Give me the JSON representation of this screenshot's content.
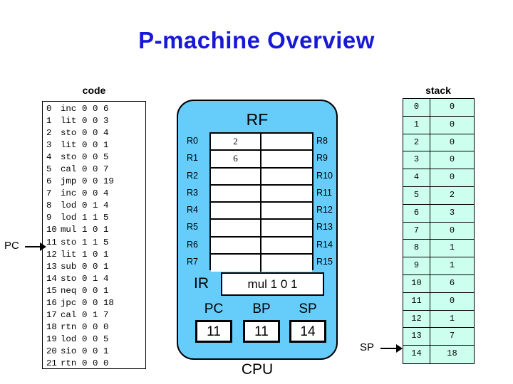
{
  "title": "P-machine Overview",
  "title_color": "#1818d8",
  "code_panel": {
    "header": "code",
    "pointer_label": "PC",
    "pointer_target_line": 11,
    "instructions": [
      {
        "index": "0",
        "op": "inc",
        "l": "0",
        "m": "0",
        "n": "6"
      },
      {
        "index": "1",
        "op": "lit",
        "l": "0",
        "m": "0",
        "n": "3"
      },
      {
        "index": "2",
        "op": "sto",
        "l": "0",
        "m": "0",
        "n": "4"
      },
      {
        "index": "3",
        "op": "lit",
        "l": "0",
        "m": "0",
        "n": "1"
      },
      {
        "index": "4",
        "op": "sto",
        "l": "0",
        "m": "0",
        "n": "5"
      },
      {
        "index": "5",
        "op": "cal",
        "l": "0",
        "m": "0",
        "n": "7"
      },
      {
        "index": "6",
        "op": "jmp",
        "l": "0",
        "m": "0",
        "n": "19"
      },
      {
        "index": "7",
        "op": "inc",
        "l": "0",
        "m": "0",
        "n": "4"
      },
      {
        "index": "8",
        "op": "lod",
        "l": "0",
        "m": "1",
        "n": "4"
      },
      {
        "index": "9",
        "op": "lod",
        "l": "1",
        "m": "1",
        "n": "5"
      },
      {
        "index": "10",
        "op": "mul",
        "l": "1",
        "m": "0",
        "n": "1"
      },
      {
        "index": "11",
        "op": "sto",
        "l": "1",
        "m": "1",
        "n": "5"
      },
      {
        "index": "12",
        "op": "lit",
        "l": "1",
        "m": "0",
        "n": "1"
      },
      {
        "index": "13",
        "op": "sub",
        "l": "0",
        "m": "0",
        "n": "1"
      },
      {
        "index": "14",
        "op": "sto",
        "l": "0",
        "m": "1",
        "n": "4"
      },
      {
        "index": "15",
        "op": "neq",
        "l": "0",
        "m": "0",
        "n": "1"
      },
      {
        "index": "16",
        "op": "jpc",
        "l": "0",
        "m": "0",
        "n": "18"
      },
      {
        "index": "17",
        "op": "cal",
        "l": "0",
        "m": "1",
        "n": "7"
      },
      {
        "index": "18",
        "op": "rtn",
        "l": "0",
        "m": "0",
        "n": "0"
      },
      {
        "index": "19",
        "op": "lod",
        "l": "0",
        "m": "0",
        "n": "5"
      },
      {
        "index": "20",
        "op": "sio",
        "l": "0",
        "m": "0",
        "n": "1"
      },
      {
        "index": "21",
        "op": "rtn",
        "l": "0",
        "m": "0",
        "n": "0"
      }
    ]
  },
  "cpu": {
    "caption": "CPU",
    "fill_color": "#66CCFA",
    "rf_title": "RF",
    "registers": [
      {
        "left_label": "R0",
        "left_value": "2",
        "right_label": "R8",
        "right_value": ""
      },
      {
        "left_label": "R1",
        "left_value": "6",
        "right_label": "R9",
        "right_value": ""
      },
      {
        "left_label": "R2",
        "left_value": "",
        "right_label": "R10",
        "right_value": ""
      },
      {
        "left_label": "R3",
        "left_value": "",
        "right_label": "R11",
        "right_value": ""
      },
      {
        "left_label": "R4",
        "left_value": "",
        "right_label": "R12",
        "right_value": ""
      },
      {
        "left_label": "R5",
        "left_value": "",
        "right_label": "R13",
        "right_value": ""
      },
      {
        "left_label": "R6",
        "left_value": "",
        "right_label": "R14",
        "right_value": ""
      },
      {
        "left_label": "R7",
        "left_value": "",
        "right_label": "R15",
        "right_value": ""
      }
    ],
    "ir": {
      "label": "IR",
      "value": "mul 1 0 1"
    },
    "pc": {
      "label": "PC",
      "value": "11"
    },
    "bp": {
      "label": "BP",
      "value": "11"
    },
    "sp": {
      "label": "SP",
      "value": "14"
    }
  },
  "stack_panel": {
    "header": "stack",
    "pointer_label": "SP",
    "pointer_target_index": 14,
    "cell_color": "#CCFFEE",
    "rows": [
      {
        "index": "0",
        "value": "0"
      },
      {
        "index": "1",
        "value": "0"
      },
      {
        "index": "2",
        "value": "0"
      },
      {
        "index": "3",
        "value": "0"
      },
      {
        "index": "4",
        "value": "0"
      },
      {
        "index": "5",
        "value": "2"
      },
      {
        "index": "6",
        "value": "3"
      },
      {
        "index": "7",
        "value": "0"
      },
      {
        "index": "8",
        "value": "1"
      },
      {
        "index": "9",
        "value": "1"
      },
      {
        "index": "10",
        "value": "6"
      },
      {
        "index": "11",
        "value": "0"
      },
      {
        "index": "12",
        "value": "1"
      },
      {
        "index": "13",
        "value": "7"
      },
      {
        "index": "14",
        "value": "18"
      }
    ]
  }
}
